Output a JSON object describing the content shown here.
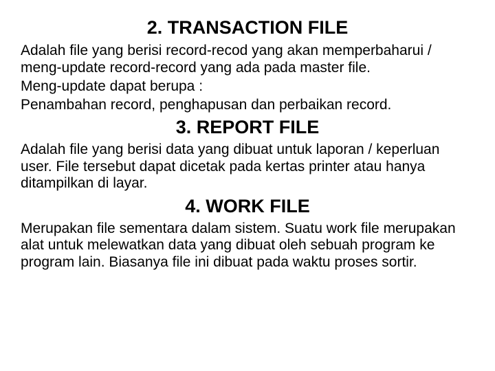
{
  "sections": [
    {
      "heading": "2. TRANSACTION FILE",
      "paragraphs": [
        "Adalah file yang berisi record-recod yang akan memperbaharui / meng-update record-record yang ada pada master file.",
        "Meng-update dapat berupa :",
        "Penambahan record, penghapusan dan perbaikan record."
      ]
    },
    {
      "heading": "3. REPORT FILE",
      "paragraphs": [
        "Adalah file yang berisi data yang dibuat untuk laporan / keperluan user. File tersebut dapat dicetak pada kertas printer atau hanya ditampilkan di layar."
      ]
    },
    {
      "heading": "4. WORK FILE",
      "paragraphs": [
        "Merupakan file sementara dalam sistem. Suatu work file merupakan alat untuk melewatkan data yang dibuat oleh sebuah program ke program lain. Biasanya file ini dibuat pada waktu proses sortir."
      ]
    }
  ]
}
